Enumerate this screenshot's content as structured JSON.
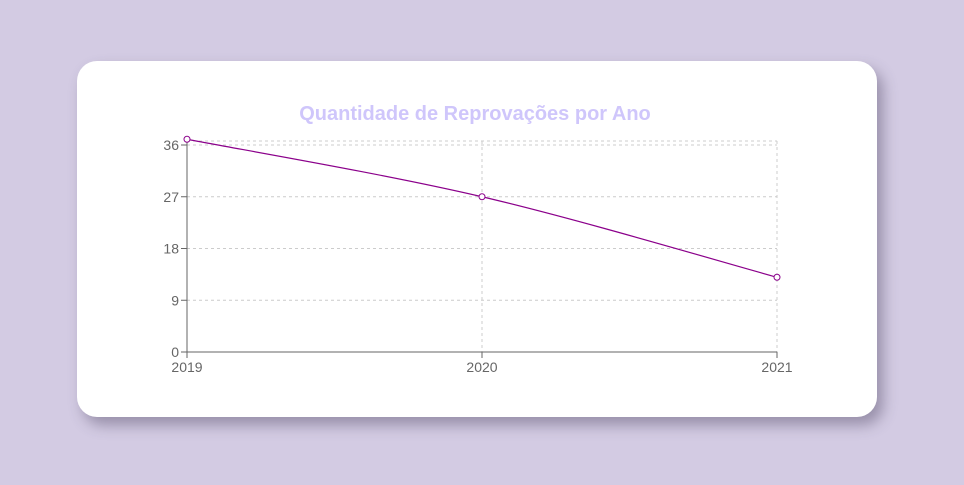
{
  "chart_data": {
    "type": "line",
    "title": "Quantidade de Reprovações por Ano",
    "xlabel": "",
    "ylabel": "",
    "x": [
      "2019",
      "2020",
      "2021"
    ],
    "series": [
      {
        "values": [
          37,
          27,
          13
        ]
      }
    ],
    "ylim": [
      0,
      36
    ],
    "yticks": [
      0,
      9,
      18,
      27,
      36
    ],
    "grid": true,
    "legend": "none"
  },
  "colors": {
    "background": "#d3cbe3",
    "card": "#ffffff",
    "title": "#cfc6fb",
    "line": "#8b008b",
    "grid": "#cccccc",
    "axis": "#666666"
  }
}
